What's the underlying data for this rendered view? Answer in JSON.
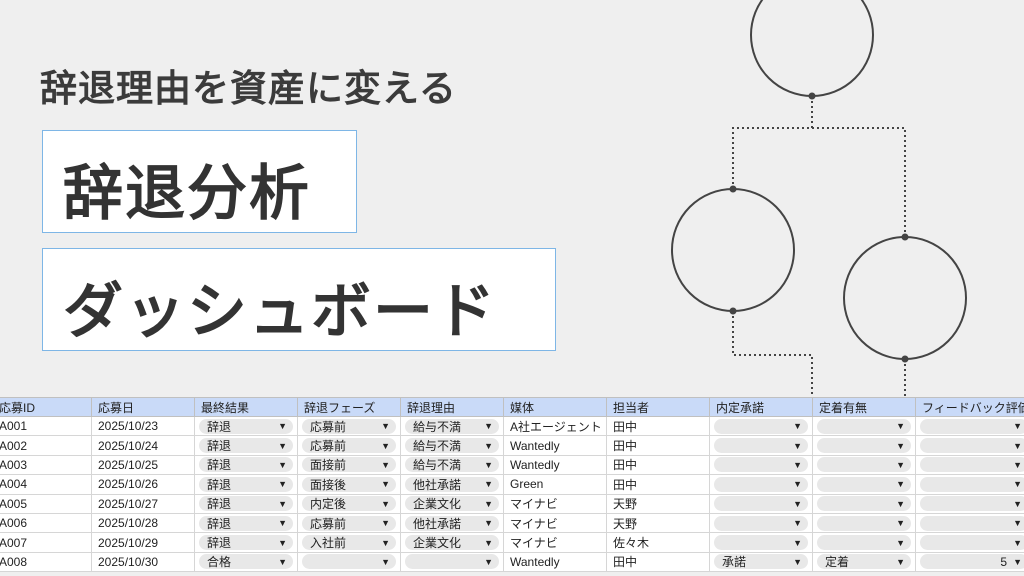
{
  "header": {
    "subtitle": "辞退理由を資産に変える",
    "title_line1": "辞退分析",
    "title_line2": "ダッシュボード"
  },
  "table": {
    "columns": [
      "応募ID",
      "応募日",
      "最終結果",
      "辞退フェーズ",
      "辞退理由",
      "媒体",
      "担当者",
      "内定承諾",
      "定着有無",
      "フィードバック評価"
    ],
    "rows": [
      {
        "id": "A001",
        "date": "2025/10/23",
        "result": "辞退",
        "phase": "応募前",
        "reason": "給与不満",
        "media": "A社エージェント",
        "owner": "田中",
        "accept": "",
        "retention": "",
        "feedback": ""
      },
      {
        "id": "A002",
        "date": "2025/10/24",
        "result": "辞退",
        "phase": "応募前",
        "reason": "給与不満",
        "media": "Wantedly",
        "owner": "田中",
        "accept": "",
        "retention": "",
        "feedback": ""
      },
      {
        "id": "A003",
        "date": "2025/10/25",
        "result": "辞退",
        "phase": "面接前",
        "reason": "給与不満",
        "media": "Wantedly",
        "owner": "田中",
        "accept": "",
        "retention": "",
        "feedback": ""
      },
      {
        "id": "A004",
        "date": "2025/10/26",
        "result": "辞退",
        "phase": "面接後",
        "reason": "他社承諾",
        "media": "Green",
        "owner": "田中",
        "accept": "",
        "retention": "",
        "feedback": ""
      },
      {
        "id": "A005",
        "date": "2025/10/27",
        "result": "辞退",
        "phase": "内定後",
        "reason": "企業文化",
        "media": "マイナビ",
        "owner": "天野",
        "accept": "",
        "retention": "",
        "feedback": ""
      },
      {
        "id": "A006",
        "date": "2025/10/28",
        "result": "辞退",
        "phase": "応募前",
        "reason": "他社承諾",
        "media": "マイナビ",
        "owner": "天野",
        "accept": "",
        "retention": "",
        "feedback": ""
      },
      {
        "id": "A007",
        "date": "2025/10/29",
        "result": "辞退",
        "phase": "入社前",
        "reason": "企業文化",
        "media": "マイナビ",
        "owner": "佐々木",
        "accept": "",
        "retention": "",
        "feedback": ""
      },
      {
        "id": "A008",
        "date": "2025/10/30",
        "result": "合格",
        "phase": "",
        "reason": "",
        "media": "Wantedly",
        "owner": "田中",
        "accept": "承諾",
        "retention": "定着",
        "feedback": "5"
      }
    ]
  },
  "dropdown_arrow": "▼",
  "colors": {
    "background": "#efefef",
    "header_row": "#c9daf8",
    "title_border": "#7eb6e6",
    "chip": "#e8e8e8",
    "flow_line": "#444444"
  }
}
